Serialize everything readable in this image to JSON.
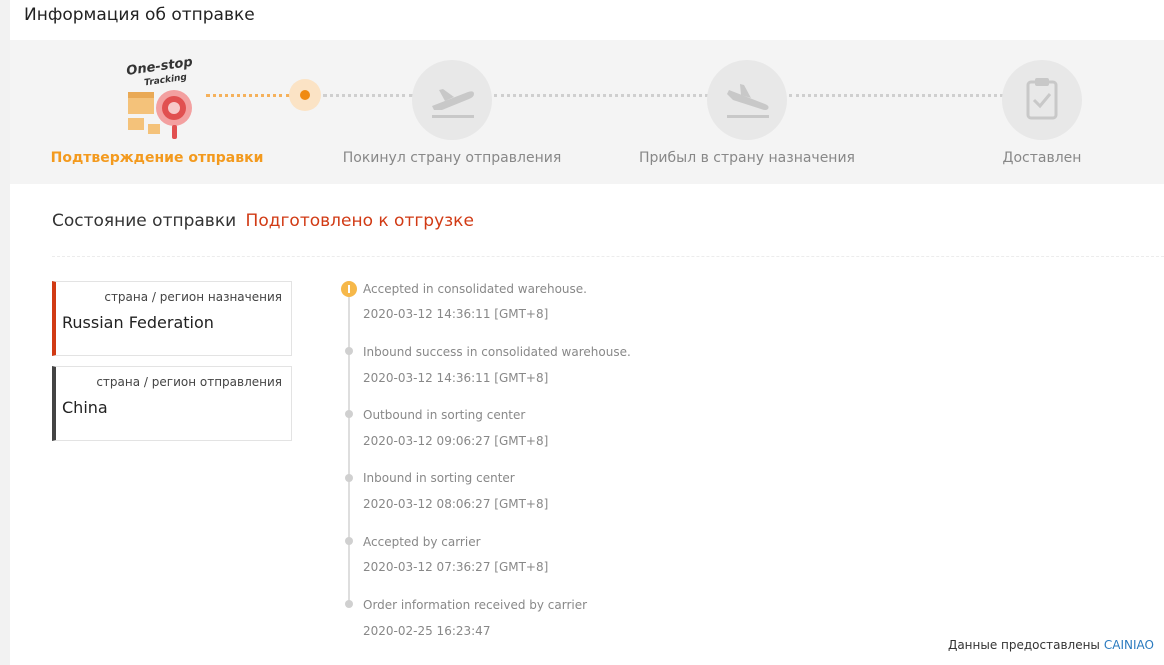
{
  "header": {
    "title": "Информация об отправке"
  },
  "logo": {
    "line1": "One-stop",
    "line2": "Tracking"
  },
  "steps": [
    {
      "label": "Подтверждение отправки",
      "state": "active"
    },
    {
      "label": "Покинул страну отправления",
      "state": "pending",
      "icon": "plane-takeoff-icon"
    },
    {
      "label": "Прибыл в страну назначения",
      "state": "pending",
      "icon": "plane-landing-icon"
    },
    {
      "label": "Доставлен",
      "state": "pending",
      "icon": "clipboard-check-icon"
    }
  ],
  "status": {
    "label": "Состояние отправки",
    "value": "Подготовлено к отгрузке"
  },
  "regions": {
    "destination": {
      "caption": "страна / регион назначения",
      "value": "Russian Federation"
    },
    "origin": {
      "caption": "страна / регион отправления",
      "value": "China"
    }
  },
  "events": [
    {
      "desc": "Accepted in consolidated warehouse.",
      "time": "2020-03-12 14:36:11 [GMT+8]"
    },
    {
      "desc": "Inbound success in consolidated warehouse.",
      "time": "2020-03-12 14:36:11 [GMT+8]"
    },
    {
      "desc": "Outbound in sorting center",
      "time": "2020-03-12 09:06:27 [GMT+8]"
    },
    {
      "desc": "Inbound in sorting center",
      "time": "2020-03-12 08:06:27 [GMT+8]"
    },
    {
      "desc": "Accepted by carrier",
      "time": "2020-03-12 07:36:27 [GMT+8]"
    },
    {
      "desc": "Order information received by carrier",
      "time": "2020-02-25 16:23:47"
    }
  ],
  "credit": {
    "prefix": "Данные предоставлены",
    "provider": "CAINIAO"
  },
  "colors": {
    "accent": "#f39a1e",
    "status": "#d13a14",
    "link": "#2b7bbf"
  }
}
